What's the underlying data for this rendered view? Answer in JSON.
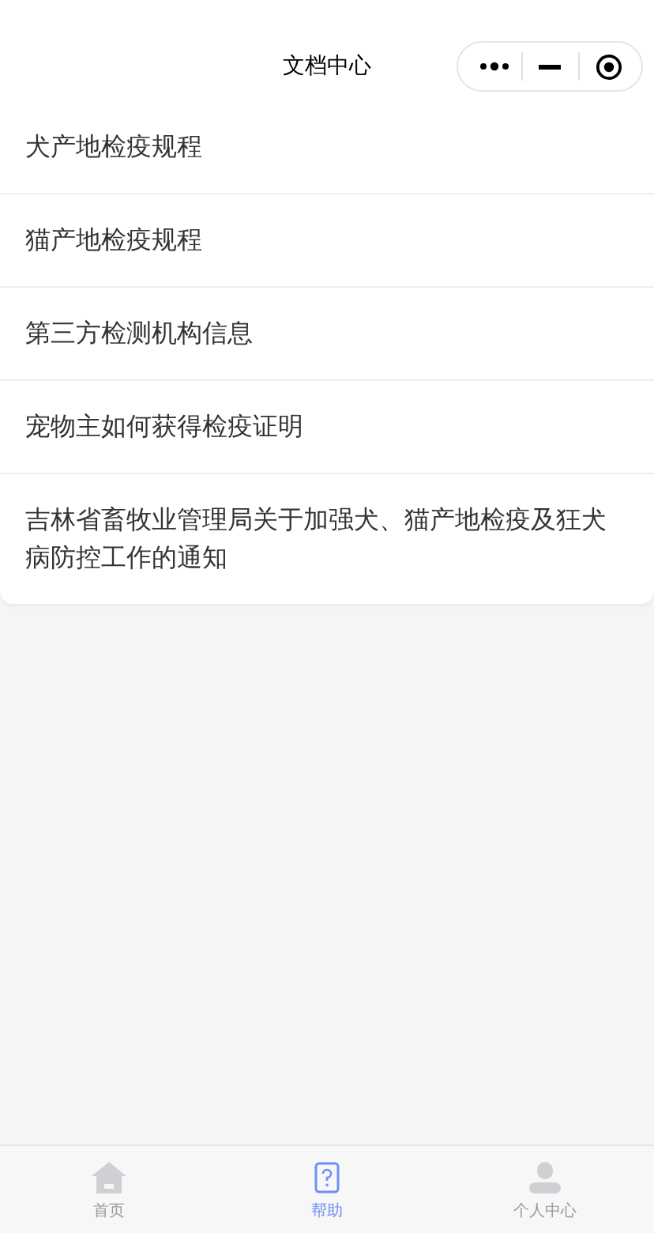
{
  "nav_bar": {
    "title": "文档中心"
  },
  "documents": [
    {
      "title": "犬产地检疫规程"
    },
    {
      "title": "猫产地检疫规程"
    },
    {
      "title": "第三方检测机构信息"
    },
    {
      "title": "宠物主如何获得检疫证明"
    },
    {
      "title": "吉林省畜牧业管理局关于加强犬、猫产地检疫及狂犬病防控工作的通知"
    }
  ],
  "tab_bar": [
    {
      "kind": "home",
      "label": "首页",
      "selected": false
    },
    {
      "kind": "help",
      "label": "帮助",
      "selected": true
    },
    {
      "kind": "profile",
      "label": "个人中心",
      "selected": false
    }
  ]
}
